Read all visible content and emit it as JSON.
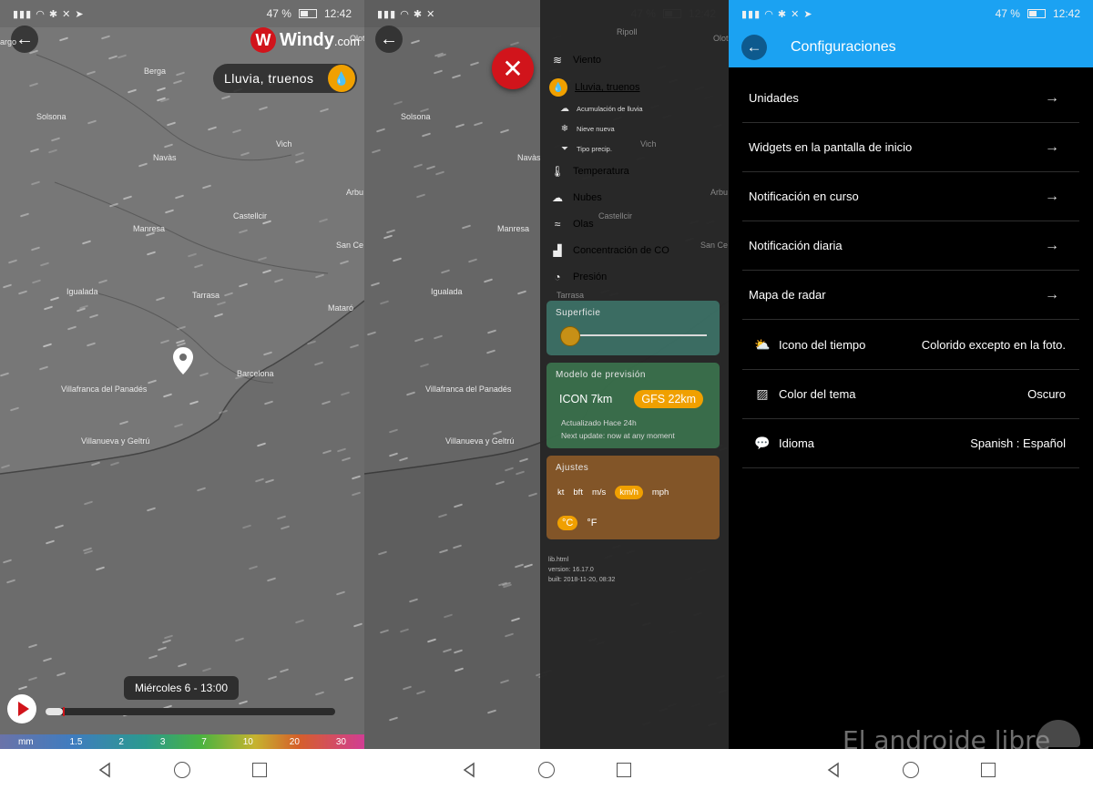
{
  "status_bar": {
    "battery": "47 %",
    "time": "12:42"
  },
  "panel1": {
    "logo": {
      "brand": "Windy",
      "suffix": ".com",
      "mark": "W"
    },
    "layer_pill": "Lluvia, truenos",
    "cities": [
      "Berga",
      "Solsona",
      "Vich",
      "Navàs",
      "Arbu",
      "Manresa",
      "Castellcir",
      "San Ce",
      "Igualada",
      "Tarrasa",
      "Mataró",
      "Barcelona",
      "Villafranca del Panadés",
      "Villanueva y Geltrú",
      "Olot",
      "argo"
    ],
    "time_label": "Miércoles 6 - 13:00",
    "timeline_progress": 0.06,
    "scale": [
      "mm",
      "1.5",
      "2",
      "3",
      "7",
      "10",
      "20",
      "30"
    ]
  },
  "panel2": {
    "cities": [
      "Ripoll",
      "Solsona",
      "Vich",
      "Navàs",
      "Manresa",
      "Castellcir",
      "San Ce",
      "Igualada",
      "Tarrasa",
      "Villafranca del Panadés",
      "Villanueva y Geltrú",
      "Arbu",
      "Olot"
    ],
    "menu": {
      "items": [
        {
          "icon": "wind-icon",
          "label": "Viento"
        },
        {
          "icon": "drop-icon",
          "label": "Lluvia, truenos"
        },
        {
          "icon": "thermometer-icon",
          "label": "Temperatura"
        },
        {
          "icon": "cloud-icon",
          "label": "Nubes"
        },
        {
          "icon": "waves-icon",
          "label": "Olas"
        },
        {
          "icon": "factory-icon",
          "label": "Concentración de CO"
        },
        {
          "icon": "gauge-icon",
          "label": "Presión"
        }
      ],
      "subitems": [
        {
          "icon": "rain-cloud-icon",
          "label": "Acumulación de lluvia"
        },
        {
          "icon": "snowflake-icon",
          "label": "Nieve nueva"
        },
        {
          "icon": "funnel-icon",
          "label": "Tipo precip."
        }
      ]
    },
    "surface_card": {
      "title": "Superficie",
      "level": 0.0
    },
    "model_card": {
      "title": "Modelo de previsión",
      "option1": "ICON 7km",
      "option2": "GFS 22km",
      "updated": "Actualizado Hace 24h",
      "next": "Next update: now at any moment"
    },
    "settings_card": {
      "title": "Ajustes",
      "wind_units": [
        "kt",
        "bft",
        "m/s",
        "km/h",
        "mph"
      ],
      "wind_selected": "km/h",
      "temp_units": [
        "°C",
        "°F"
      ],
      "temp_selected": "°C"
    },
    "meta": {
      "lib": "lib.html",
      "version": "version: 16.17.0",
      "built": "built: 2018-11-20, 08:32"
    }
  },
  "panel3": {
    "title": "Configuraciones",
    "rows": [
      {
        "label": "Unidades",
        "value": ""
      },
      {
        "label": "Widgets en la pantalla de inicio",
        "value": ""
      },
      {
        "label": "Notificación en curso",
        "value": ""
      },
      {
        "label": "Notificación diaria",
        "value": ""
      },
      {
        "label": "Mapa de radar",
        "value": ""
      },
      {
        "label": "Icono del tiempo",
        "value": "Colorido excepto en la foto."
      },
      {
        "label": "Color del tema",
        "value": "Oscuro"
      },
      {
        "label": "Idioma",
        "value": "Spanish : Español"
      }
    ]
  },
  "watermark": "El androide libre",
  "colors": {
    "accent": "#1ba2f2",
    "windy_red": "#d1141b",
    "orange": "#f0a000",
    "map": "#6c6c6c"
  }
}
